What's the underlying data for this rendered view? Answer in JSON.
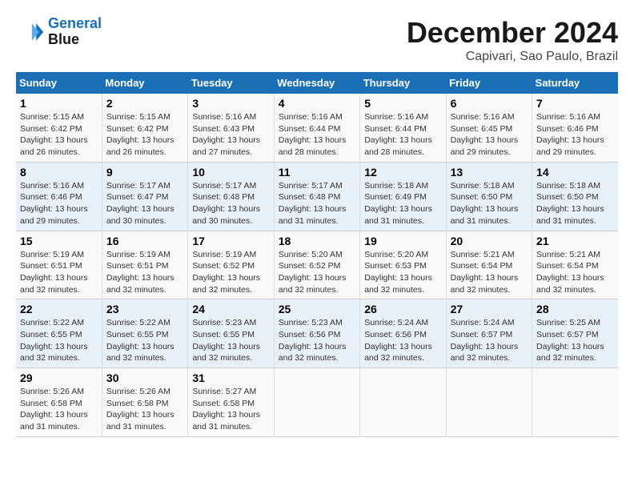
{
  "logo": {
    "line1": "General",
    "line2": "Blue"
  },
  "title": "December 2024",
  "subtitle": "Capivari, Sao Paulo, Brazil",
  "days_header": [
    "Sunday",
    "Monday",
    "Tuesday",
    "Wednesday",
    "Thursday",
    "Friday",
    "Saturday"
  ],
  "weeks": [
    [
      {
        "day": "1",
        "sunrise": "5:15 AM",
        "sunset": "6:42 PM",
        "daylight": "13 hours and 26 minutes."
      },
      {
        "day": "2",
        "sunrise": "5:15 AM",
        "sunset": "6:42 PM",
        "daylight": "13 hours and 26 minutes."
      },
      {
        "day": "3",
        "sunrise": "5:16 AM",
        "sunset": "6:43 PM",
        "daylight": "13 hours and 27 minutes."
      },
      {
        "day": "4",
        "sunrise": "5:16 AM",
        "sunset": "6:44 PM",
        "daylight": "13 hours and 28 minutes."
      },
      {
        "day": "5",
        "sunrise": "5:16 AM",
        "sunset": "6:44 PM",
        "daylight": "13 hours and 28 minutes."
      },
      {
        "day": "6",
        "sunrise": "5:16 AM",
        "sunset": "6:45 PM",
        "daylight": "13 hours and 29 minutes."
      },
      {
        "day": "7",
        "sunrise": "5:16 AM",
        "sunset": "6:46 PM",
        "daylight": "13 hours and 29 minutes."
      }
    ],
    [
      {
        "day": "8",
        "sunrise": "5:16 AM",
        "sunset": "6:46 PM",
        "daylight": "13 hours and 29 minutes."
      },
      {
        "day": "9",
        "sunrise": "5:17 AM",
        "sunset": "6:47 PM",
        "daylight": "13 hours and 30 minutes."
      },
      {
        "day": "10",
        "sunrise": "5:17 AM",
        "sunset": "6:48 PM",
        "daylight": "13 hours and 30 minutes."
      },
      {
        "day": "11",
        "sunrise": "5:17 AM",
        "sunset": "6:48 PM",
        "daylight": "13 hours and 31 minutes."
      },
      {
        "day": "12",
        "sunrise": "5:18 AM",
        "sunset": "6:49 PM",
        "daylight": "13 hours and 31 minutes."
      },
      {
        "day": "13",
        "sunrise": "5:18 AM",
        "sunset": "6:50 PM",
        "daylight": "13 hours and 31 minutes."
      },
      {
        "day": "14",
        "sunrise": "5:18 AM",
        "sunset": "6:50 PM",
        "daylight": "13 hours and 31 minutes."
      }
    ],
    [
      {
        "day": "15",
        "sunrise": "5:19 AM",
        "sunset": "6:51 PM",
        "daylight": "13 hours and 32 minutes."
      },
      {
        "day": "16",
        "sunrise": "5:19 AM",
        "sunset": "6:51 PM",
        "daylight": "13 hours and 32 minutes."
      },
      {
        "day": "17",
        "sunrise": "5:19 AM",
        "sunset": "6:52 PM",
        "daylight": "13 hours and 32 minutes."
      },
      {
        "day": "18",
        "sunrise": "5:20 AM",
        "sunset": "6:52 PM",
        "daylight": "13 hours and 32 minutes."
      },
      {
        "day": "19",
        "sunrise": "5:20 AM",
        "sunset": "6:53 PM",
        "daylight": "13 hours and 32 minutes."
      },
      {
        "day": "20",
        "sunrise": "5:21 AM",
        "sunset": "6:54 PM",
        "daylight": "13 hours and 32 minutes."
      },
      {
        "day": "21",
        "sunrise": "5:21 AM",
        "sunset": "6:54 PM",
        "daylight": "13 hours and 32 minutes."
      }
    ],
    [
      {
        "day": "22",
        "sunrise": "5:22 AM",
        "sunset": "6:55 PM",
        "daylight": "13 hours and 32 minutes."
      },
      {
        "day": "23",
        "sunrise": "5:22 AM",
        "sunset": "6:55 PM",
        "daylight": "13 hours and 32 minutes."
      },
      {
        "day": "24",
        "sunrise": "5:23 AM",
        "sunset": "6:55 PM",
        "daylight": "13 hours and 32 minutes."
      },
      {
        "day": "25",
        "sunrise": "5:23 AM",
        "sunset": "6:56 PM",
        "daylight": "13 hours and 32 minutes."
      },
      {
        "day": "26",
        "sunrise": "5:24 AM",
        "sunset": "6:56 PM",
        "daylight": "13 hours and 32 minutes."
      },
      {
        "day": "27",
        "sunrise": "5:24 AM",
        "sunset": "6:57 PM",
        "daylight": "13 hours and 32 minutes."
      },
      {
        "day": "28",
        "sunrise": "5:25 AM",
        "sunset": "6:57 PM",
        "daylight": "13 hours and 32 minutes."
      }
    ],
    [
      {
        "day": "29",
        "sunrise": "5:26 AM",
        "sunset": "6:58 PM",
        "daylight": "13 hours and 31 minutes."
      },
      {
        "day": "30",
        "sunrise": "5:26 AM",
        "sunset": "6:58 PM",
        "daylight": "13 hours and 31 minutes."
      },
      {
        "day": "31",
        "sunrise": "5:27 AM",
        "sunset": "6:58 PM",
        "daylight": "13 hours and 31 minutes."
      },
      null,
      null,
      null,
      null
    ]
  ]
}
